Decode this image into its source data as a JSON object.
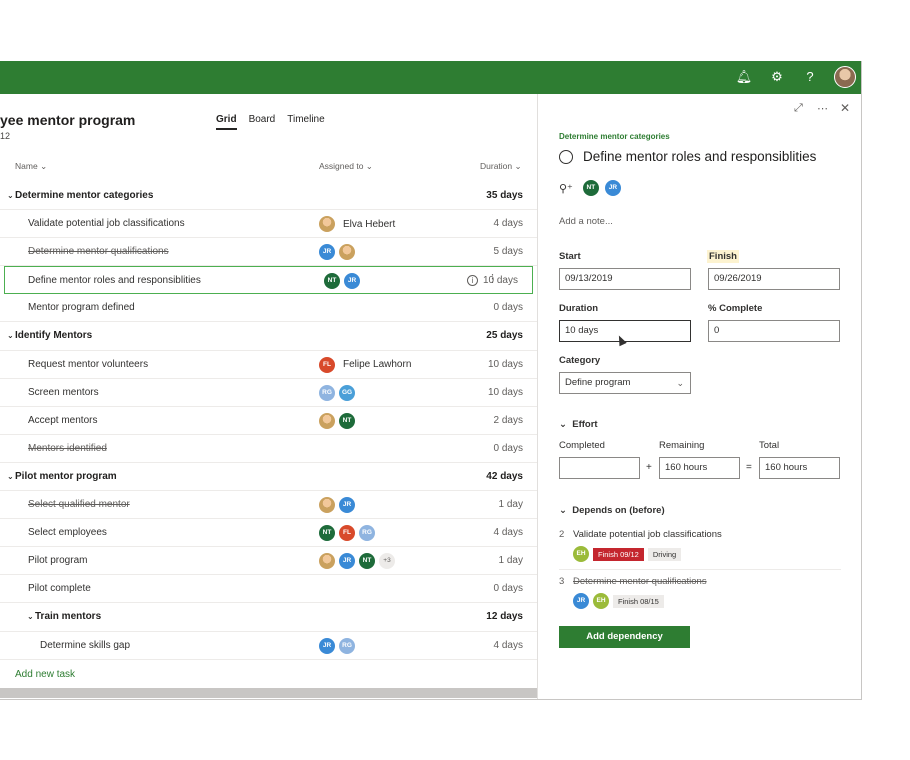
{
  "topbar": {
    "bg": "#2e7d32",
    "icons": [
      "bell-icon",
      "gear-icon",
      "help-icon"
    ]
  },
  "project": {
    "title": "yee mentor program",
    "subtitle": "12"
  },
  "views": [
    "Grid",
    "Board",
    "Timeline"
  ],
  "columns": {
    "name": "Name",
    "assigned": "Assigned to",
    "duration": "Duration"
  },
  "rows": [
    {
      "type": "group",
      "indent": 0,
      "name": "Determine mentor categories",
      "duration": "35 days",
      "done": false,
      "assignees": [],
      "assignee_name": ""
    },
    {
      "type": "task",
      "indent": 1,
      "name": "Validate potential job classifications",
      "duration": "4 days",
      "done": false,
      "assignees": [
        "photo"
      ],
      "assignee_name": "Elva Hebert"
    },
    {
      "type": "task",
      "indent": 1,
      "name": "Determine mentor qualifications",
      "duration": "5 days",
      "done": true,
      "assignees": [
        "JR",
        "photo"
      ],
      "assignee_name": ""
    },
    {
      "type": "task",
      "indent": 1,
      "name": "Define mentor roles and responsiblities",
      "duration": "10 days",
      "done": false,
      "assignees": [
        "NT",
        "JR"
      ],
      "assignee_name": "",
      "selected": true
    },
    {
      "type": "task",
      "indent": 1,
      "name": "Mentor program defined",
      "duration": "0 days",
      "done": false,
      "assignees": [],
      "assignee_name": ""
    },
    {
      "type": "group",
      "indent": 0,
      "name": "Identify Mentors",
      "duration": "25 days",
      "done": false,
      "assignees": [],
      "assignee_name": ""
    },
    {
      "type": "task",
      "indent": 1,
      "name": "Request mentor volunteers",
      "duration": "10 days",
      "done": false,
      "assignees": [
        "FL"
      ],
      "assignee_name": "Felipe Lawhorn"
    },
    {
      "type": "task",
      "indent": 1,
      "name": "Screen mentors",
      "duration": "10 days",
      "done": false,
      "assignees": [
        "RG",
        "GG"
      ],
      "assignee_name": ""
    },
    {
      "type": "task",
      "indent": 1,
      "name": "Accept mentors",
      "duration": "2 days",
      "done": false,
      "assignees": [
        "photo",
        "NT"
      ],
      "assignee_name": ""
    },
    {
      "type": "task",
      "indent": 1,
      "name": "Mentors identified",
      "duration": "0 days",
      "done": true,
      "assignees": [],
      "assignee_name": ""
    },
    {
      "type": "group",
      "indent": 0,
      "name": "Pilot mentor program",
      "duration": "42 days",
      "done": false,
      "assignees": [],
      "assignee_name": ""
    },
    {
      "type": "task",
      "indent": 1,
      "name": "Select qualified mentor",
      "duration": "1 day",
      "done": true,
      "assignees": [
        "photo",
        "JR"
      ],
      "assignee_name": ""
    },
    {
      "type": "task",
      "indent": 1,
      "name": "Select employees",
      "duration": "4 days",
      "done": false,
      "assignees": [
        "NT",
        "FL",
        "RG"
      ],
      "assignee_name": ""
    },
    {
      "type": "task",
      "indent": 1,
      "name": "Pilot program",
      "duration": "1 day",
      "done": false,
      "assignees": [
        "photo",
        "JR",
        "NT",
        "+3"
      ],
      "assignee_name": ""
    },
    {
      "type": "task",
      "indent": 1,
      "name": "Pilot complete",
      "duration": "0 days",
      "done": false,
      "assignees": [],
      "assignee_name": ""
    },
    {
      "type": "group",
      "indent": 1,
      "name": "Train mentors",
      "duration": "12 days",
      "done": false,
      "assignees": [],
      "assignee_name": ""
    },
    {
      "type": "task",
      "indent": 2,
      "name": "Determine skills gap",
      "duration": "4 days",
      "done": false,
      "assignees": [
        "JR",
        "RG"
      ],
      "assignee_name": ""
    }
  ],
  "add_task": "Add new task",
  "detail": {
    "bucket": "Determine mentor categories",
    "title": "Define mentor roles and responsiblities",
    "assignees": [
      "NT",
      "JR"
    ],
    "note_placeholder": "Add a note...",
    "start_label": "Start",
    "start": "09/13/2019",
    "finish_label": "Finish",
    "finish": "09/26/2019",
    "duration_label": "Duration",
    "duration": "10 days",
    "complete_label": "% Complete",
    "complete": "0",
    "category_label": "Category",
    "category": "Define program",
    "effort_label": "Effort",
    "completed_label": "Completed",
    "completed": "",
    "remaining_label": "Remaining",
    "remaining": "160 hours",
    "total_label": "Total",
    "total": "160 hours",
    "depends_label": "Depends on (before)",
    "dependencies": [
      {
        "num": "2",
        "name": "Validate potential job classifications",
        "done": false,
        "avatar": "EH",
        "chips": [
          {
            "text": "Finish 09/12",
            "red": true
          },
          {
            "text": "Driving",
            "red": false
          }
        ]
      },
      {
        "num": "3",
        "name": "Determine mentor qualifications",
        "done": true,
        "avatar": "JR",
        "avatar2": "EH",
        "chips": [
          {
            "text": "Finish 08/15",
            "red": false
          }
        ]
      }
    ],
    "add_dependency": "Add dependency"
  }
}
